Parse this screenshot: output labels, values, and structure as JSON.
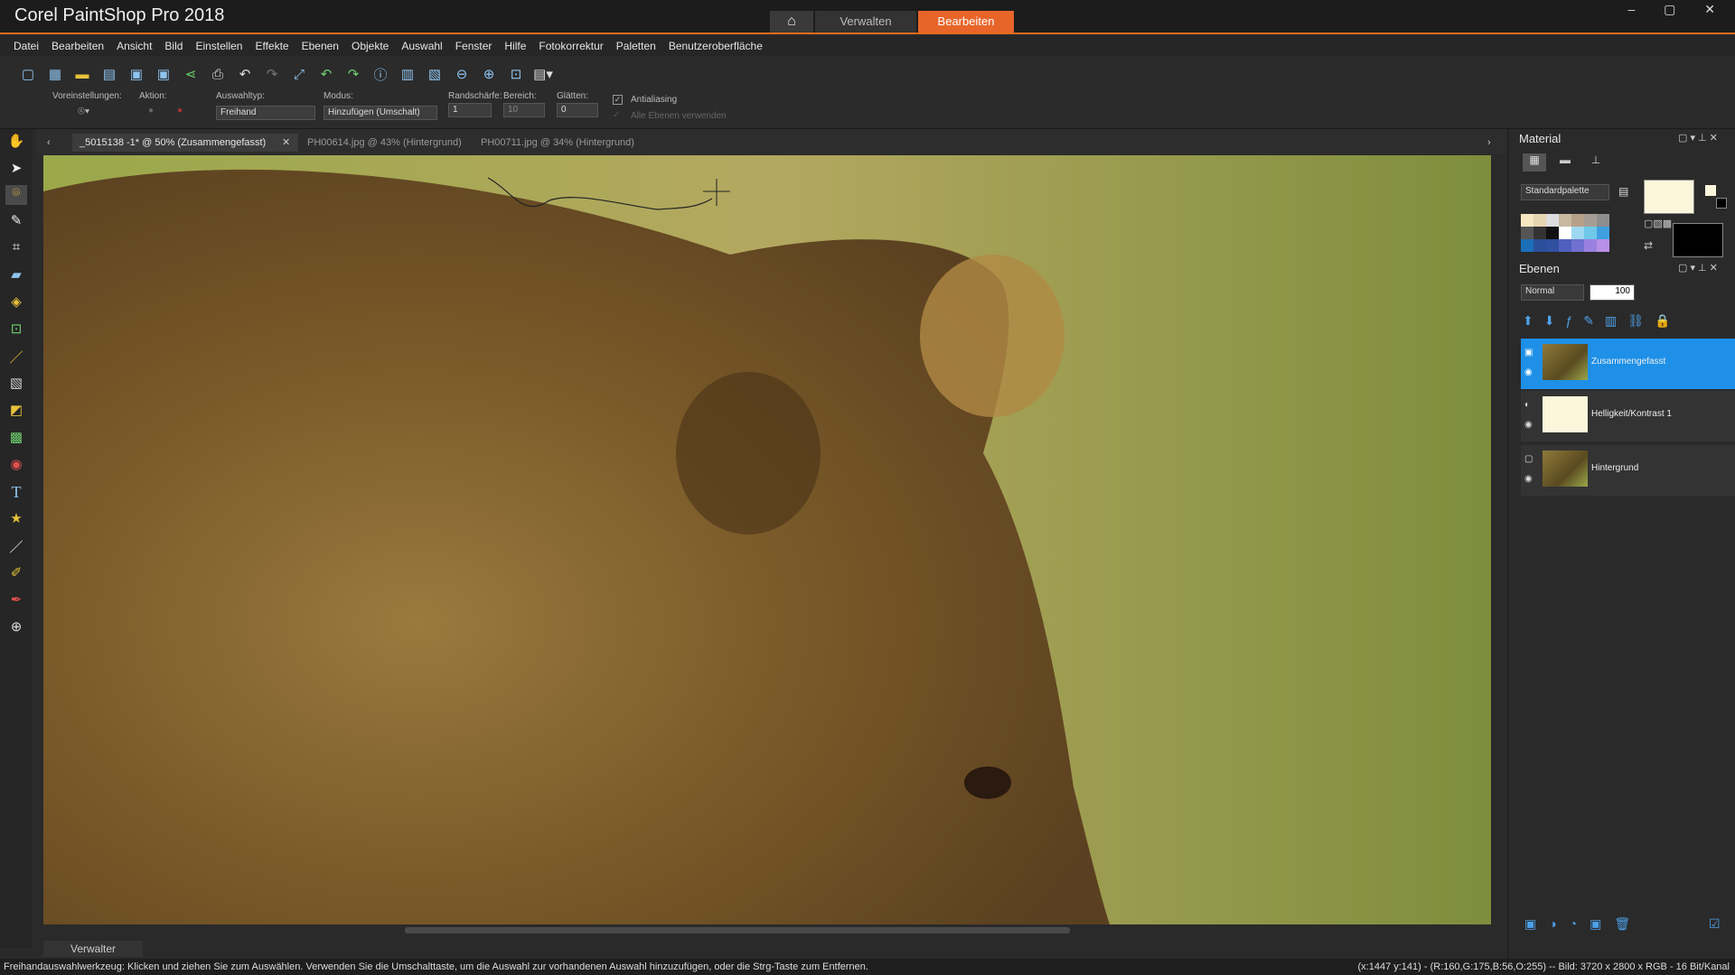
{
  "app": {
    "title": "Corel PaintShop Pro 2018",
    "home": "⌂",
    "tab_manage": "Verwalten",
    "tab_edit": "Bearbeiten",
    "win": "–  ▢  ✕"
  },
  "menu": [
    "Datei",
    "Bearbeiten",
    "Ansicht",
    "Bild",
    "Einstellen",
    "Effekte",
    "Ebenen",
    "Objekte",
    "Auswahl",
    "Fenster",
    "Hilfe",
    "Fotokorrektur",
    "Paletten",
    "Benutzeroberfläche"
  ],
  "toolbar_icons": [
    "new-icon",
    "grid-icon",
    "open-icon",
    "scan-icon",
    "save-icon",
    "save-as-icon",
    "share-icon",
    "print-icon",
    "undo-icon",
    "redo-icon",
    "crop-fit-icon",
    "undo-history-icon",
    "redo-history-icon",
    "info-icon",
    "fit-window-icon",
    "actual-size-icon",
    "zoom-out-icon",
    "zoom-in-icon",
    "zoom-fit-icon",
    "paste-icon"
  ],
  "options": {
    "presets_label": "Voreinstellungen:",
    "action_label": "Aktion:",
    "select_type_label": "Auswahltyp:",
    "select_type_value": "Freihand",
    "mode_label": "Modus:",
    "mode_value": "Hinzufügen (Umschalt)",
    "feather_label": "Randschärfe:",
    "feather_value": "1",
    "range_label": "Bereich:",
    "range_value": "10",
    "smoothing_label": "Glätten:",
    "smoothing_value": "0",
    "antialias_label": "Antialiasing",
    "all_layers_label": "Alle Ebenen verwenden"
  },
  "doc_tabs": [
    "_5015138 -1* @  50% (Zusammengefasst)",
    "PH00614.jpg @  43% (Hintergrund)",
    "PH00711.jpg @  34% (Hintergrund)"
  ],
  "material": {
    "title": "Material",
    "palette": "Standardpalette",
    "fg": "#fbf6dc",
    "bg": "#000000"
  },
  "layers": {
    "title": "Ebenen",
    "blend": "Normal",
    "opacity": "100",
    "items": [
      {
        "name": "Zusammengefasst",
        "selected": true
      },
      {
        "name": "Helligkeit/Kontrast 1",
        "selected": false
      },
      {
        "name": "Hintergrund",
        "selected": false
      }
    ]
  },
  "bottom_tab": "Verwalter",
  "status": {
    "left": "Freihandauswahlwerkzeug: Klicken und ziehen Sie zum Auswählen. Verwenden Sie die Umschalttaste, um die Auswahl zur vorhandenen Auswahl hinzuzufügen, oder die Strg-Taste zum Entfernen.",
    "right": "(x:1447 y:141) - (R:160,G:175,B:56,O:255) -- Bild:  3720 x 2800 x RGB - 16 Bit/Kanal"
  }
}
